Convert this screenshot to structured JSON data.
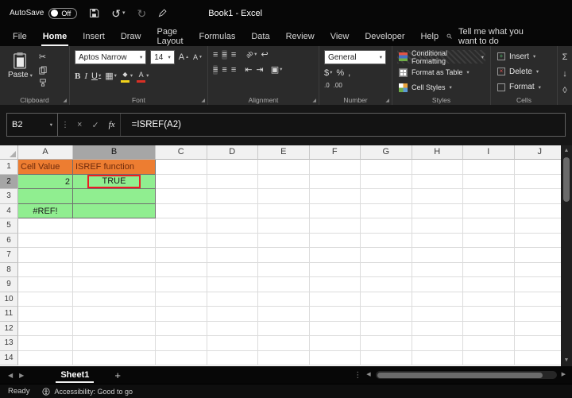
{
  "titlebar": {
    "autosave_label": "AutoSave",
    "autosave_state": "Off",
    "title": "Book1 - Excel"
  },
  "menu": {
    "items": [
      "File",
      "Home",
      "Insert",
      "Draw",
      "Page Layout",
      "Formulas",
      "Data",
      "Review",
      "View",
      "Developer",
      "Help"
    ],
    "active": "Home",
    "search_text": "Tell me what you want to do"
  },
  "ribbon": {
    "paste_label": "Paste",
    "font_name": "Aptos Narrow",
    "font_size": "14",
    "bold": "B",
    "italic": "I",
    "underline": "U",
    "number_format": "General",
    "conditional_formatting": "Conditional Formatting",
    "format_as_table": "Format as Table",
    "cell_styles": "Cell Styles",
    "insert_label": "Insert",
    "delete_label": "Delete",
    "format_label": "Format",
    "group_labels": {
      "clipboard": "Clipboard",
      "font": "Font",
      "alignment": "Alignment",
      "number": "Number",
      "styles": "Styles",
      "cells": "Cells"
    }
  },
  "icons": {
    "chevron": "▾",
    "undo": "↺",
    "redo": "↻",
    "scissors": "✂",
    "grow_font": "A",
    "shrink_font": "A",
    "up": "▲",
    "down": "▼",
    "left": "◀",
    "right": "▶",
    "align_lines": "≡",
    "orientation": "ab",
    "wrap": "↩",
    "indent_left": "⇤",
    "indent_right": "⇥",
    "merge": "▣",
    "borders": "▦",
    "fill_diamond": "◆",
    "font_color_letter": "A",
    "dollar": "$",
    "percent": "%",
    "comma": ",",
    "inc_decimal": ".0",
    "dec_decimal": ".00",
    "sigma": "Σ",
    "fill_down": "↓",
    "clear": "◊",
    "cancel": "×",
    "enter": "✓",
    "fx": "fx",
    "dots": "⋮",
    "plus": "+",
    "cross": "×",
    "launcher": "◢"
  },
  "formula_bar": {
    "name_box": "B2",
    "formula": "=ISREF(A2)"
  },
  "grid": {
    "columns": [
      "A",
      "B",
      "C",
      "D",
      "E",
      "F",
      "G",
      "H",
      "I",
      "J"
    ],
    "row_count": 14,
    "selected": {
      "col": "B",
      "row": 2,
      "ref": "B2"
    },
    "cells": [
      {
        "ref": "A1",
        "text": "Cell Value",
        "fill": "orange",
        "text_color": "orange_text",
        "align": "left"
      },
      {
        "ref": "B1",
        "text": "ISREF function",
        "fill": "orange",
        "text_color": "orange_text",
        "align": "left"
      },
      {
        "ref": "A2",
        "text": "2",
        "fill": "green",
        "align": "right"
      },
      {
        "ref": "B2",
        "text": "TRUE",
        "fill": "green",
        "align": "center"
      },
      {
        "ref": "A3",
        "text": "",
        "fill": "green"
      },
      {
        "ref": "B3",
        "text": "",
        "fill": "green"
      },
      {
        "ref": "A4",
        "text": "#REF!",
        "fill": "green",
        "align": "center"
      },
      {
        "ref": "B4",
        "text": "",
        "fill": "green"
      }
    ]
  },
  "sheet_bar": {
    "tabs": [
      "Sheet1"
    ],
    "active": "Sheet1"
  },
  "status_bar": {
    "ready": "Ready",
    "accessibility": "Accessibility: Good to go"
  },
  "colors": {
    "orange": "#ED7D31",
    "orange_text": "#6E2A0C",
    "green": "#90EE90",
    "annotation_red": "#ED1C24",
    "fill_color_bar": "#F2D31B",
    "font_color_bar": "#D93025"
  }
}
